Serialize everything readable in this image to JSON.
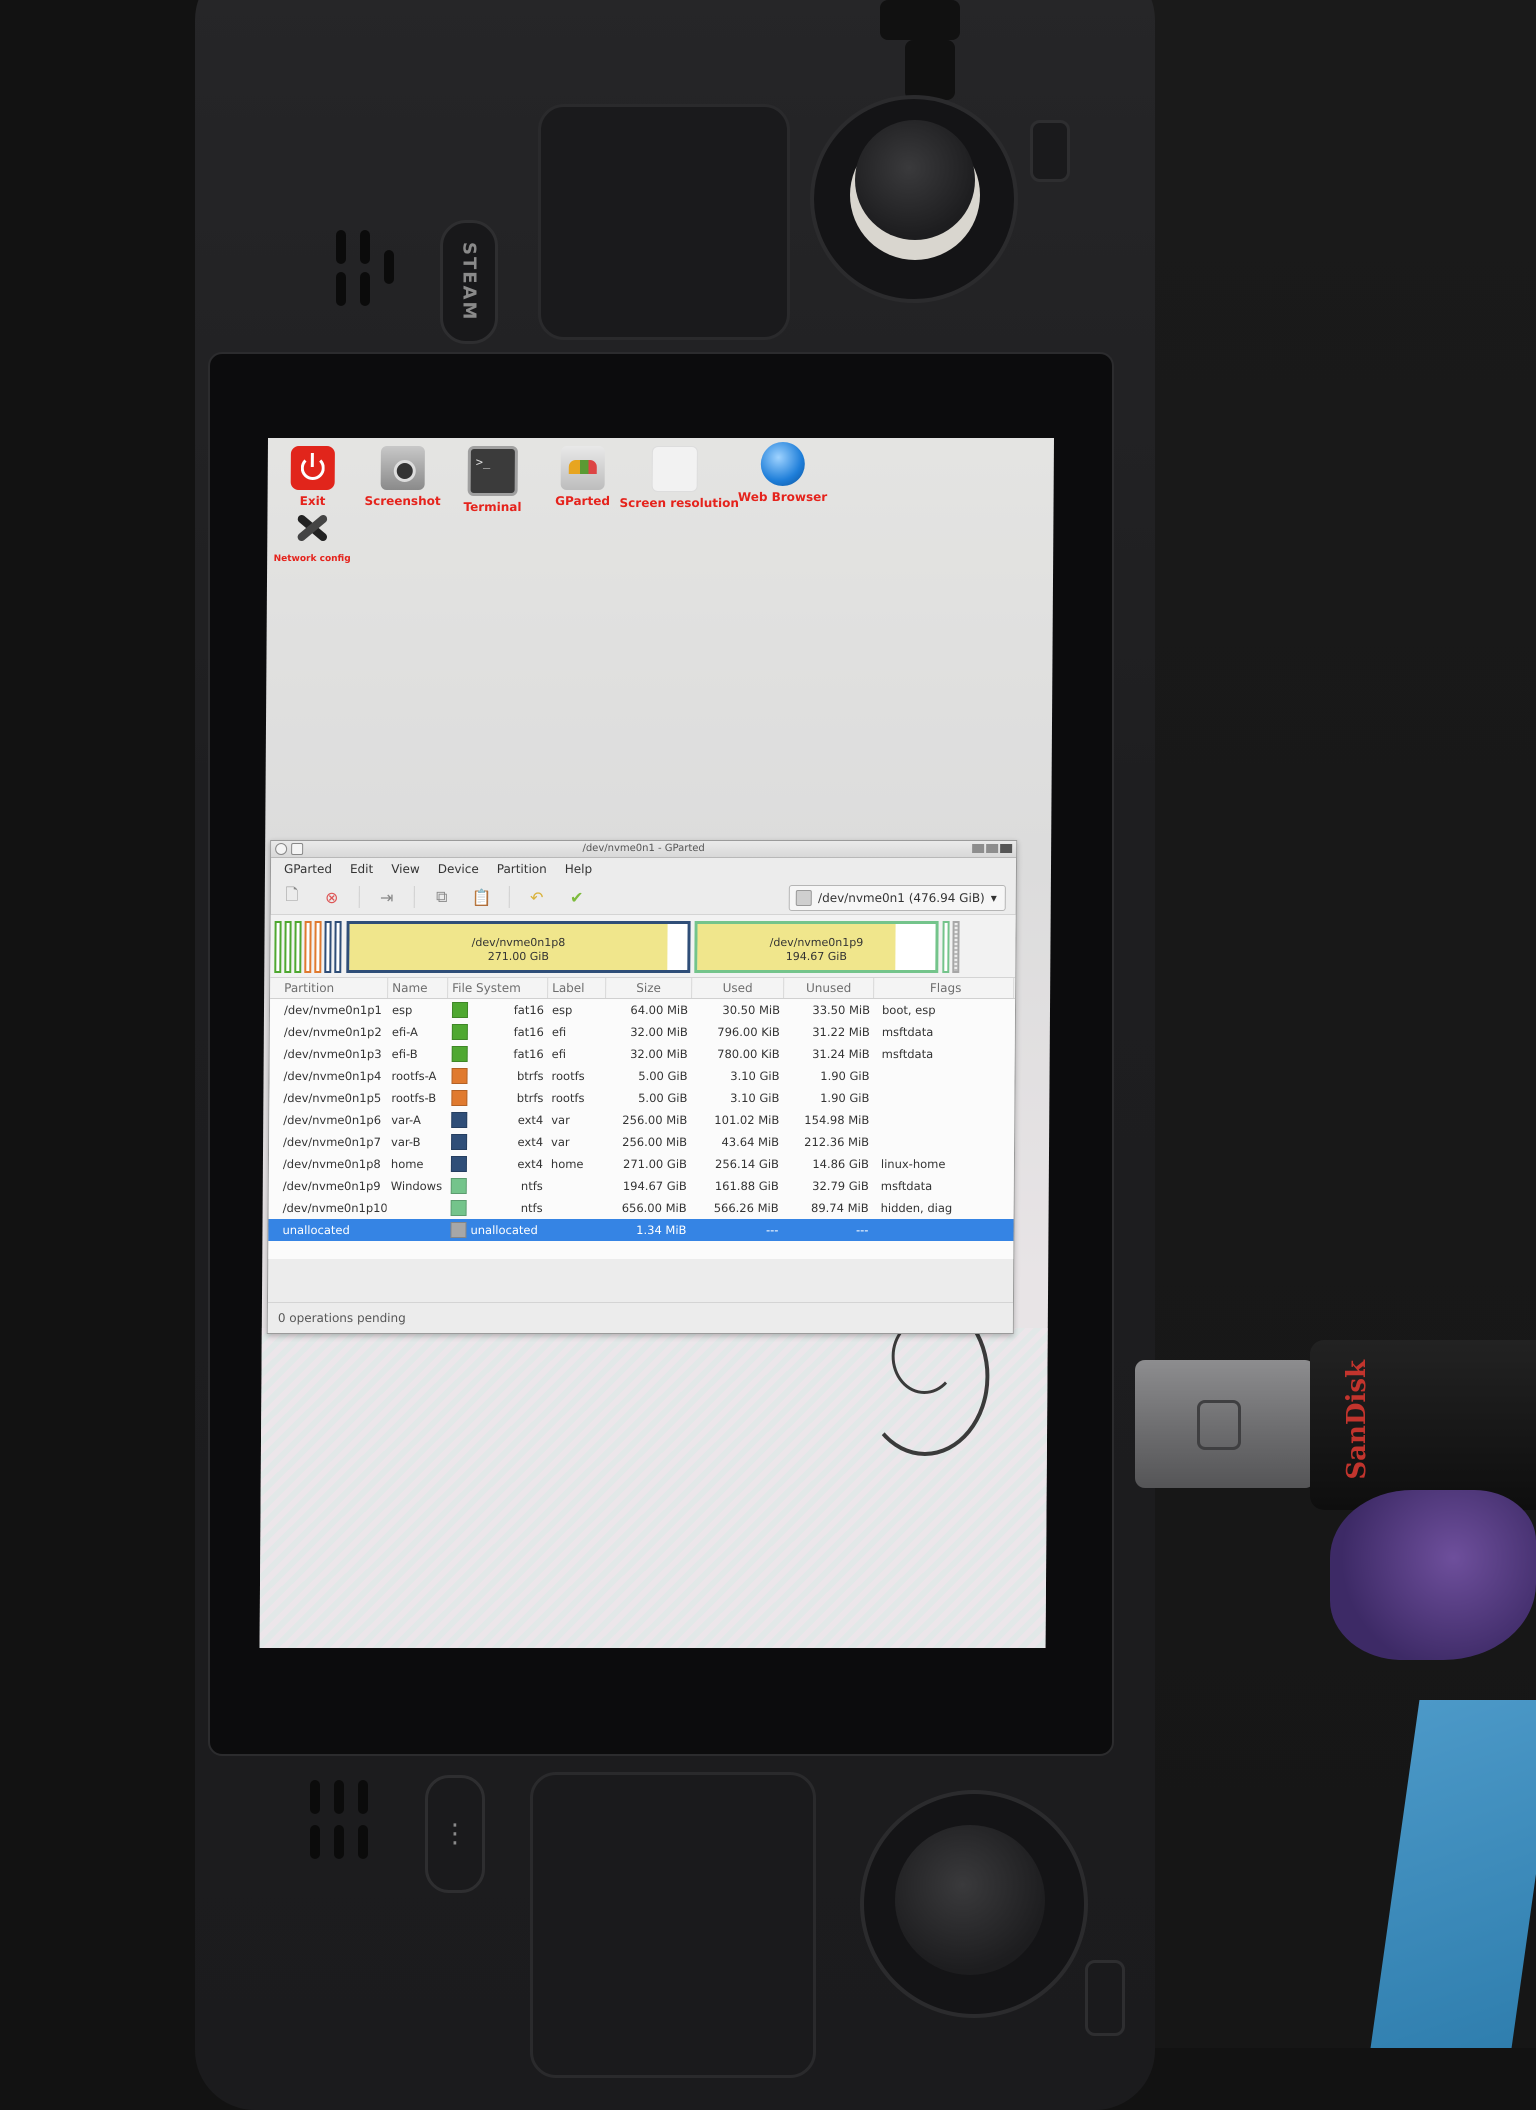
{
  "desktop": {
    "icons": [
      {
        "label": "Exit"
      },
      {
        "label": "Screenshot"
      },
      {
        "label": "Terminal"
      },
      {
        "label": "GParted"
      },
      {
        "label": "Screen resolution"
      },
      {
        "label": "Web Browser"
      },
      {
        "label": "Network config"
      }
    ]
  },
  "device": {
    "steam_label": "STEAM",
    "usb_brand": "SanDisk"
  },
  "window": {
    "title": "/dev/nvme0n1 - GParted",
    "menu": [
      "GParted",
      "Edit",
      "View",
      "Device",
      "Partition",
      "Help"
    ],
    "device_selector": "/dev/nvme0n1 (476.94 GiB)",
    "diskmap": [
      {
        "name": "/dev/nvme0n1p8",
        "size": "271.00 GiB",
        "used_fraction": 0.94
      },
      {
        "name": "/dev/nvme0n1p9",
        "size": "194.67 GiB",
        "used_fraction": 0.83
      }
    ],
    "columns": [
      "Partition",
      "Name",
      "File System",
      "Label",
      "Size",
      "Used",
      "Unused",
      "Flags"
    ],
    "rows": [
      {
        "partition": "/dev/nvme0n1p1",
        "name": "esp",
        "fs": "fat16",
        "color": "#4fa831",
        "label": "esp",
        "size": "64.00 MiB",
        "used": "30.50 MiB",
        "unused": "33.50 MiB",
        "flags": "boot, esp"
      },
      {
        "partition": "/dev/nvme0n1p2",
        "name": "efi-A",
        "fs": "fat16",
        "color": "#4fa831",
        "label": "efi",
        "size": "32.00 MiB",
        "used": "796.00 KiB",
        "unused": "31.22 MiB",
        "flags": "msftdata"
      },
      {
        "partition": "/dev/nvme0n1p3",
        "name": "efi-B",
        "fs": "fat16",
        "color": "#4fa831",
        "label": "efi",
        "size": "32.00 MiB",
        "used": "780.00 KiB",
        "unused": "31.24 MiB",
        "flags": "msftdata"
      },
      {
        "partition": "/dev/nvme0n1p4",
        "name": "rootfs-A",
        "fs": "btrfs",
        "color": "#e07a2f",
        "label": "rootfs",
        "size": "5.00 GiB",
        "used": "3.10 GiB",
        "unused": "1.90 GiB",
        "flags": ""
      },
      {
        "partition": "/dev/nvme0n1p5",
        "name": "rootfs-B",
        "fs": "btrfs",
        "color": "#e07a2f",
        "label": "rootfs",
        "size": "5.00 GiB",
        "used": "3.10 GiB",
        "unused": "1.90 GiB",
        "flags": ""
      },
      {
        "partition": "/dev/nvme0n1p6",
        "name": "var-A",
        "fs": "ext4",
        "color": "#2f4e78",
        "label": "var",
        "size": "256.00 MiB",
        "used": "101.02 MiB",
        "unused": "154.98 MiB",
        "flags": ""
      },
      {
        "partition": "/dev/nvme0n1p7",
        "name": "var-B",
        "fs": "ext4",
        "color": "#2f4e78",
        "label": "var",
        "size": "256.00 MiB",
        "used": "43.64 MiB",
        "unused": "212.36 MiB",
        "flags": ""
      },
      {
        "partition": "/dev/nvme0n1p8",
        "name": "home",
        "fs": "ext4",
        "color": "#2f4e78",
        "label": "home",
        "size": "271.00 GiB",
        "used": "256.14 GiB",
        "unused": "14.86 GiB",
        "flags": "linux-home"
      },
      {
        "partition": "/dev/nvme0n1p9",
        "name": "Windows",
        "fs": "ntfs",
        "color": "#74c48b",
        "label": "",
        "size": "194.67 GiB",
        "used": "161.88 GiB",
        "unused": "32.79 GiB",
        "flags": "msftdata"
      },
      {
        "partition": "/dev/nvme0n1p10",
        "name": "",
        "fs": "ntfs",
        "color": "#74c48b",
        "label": "",
        "size": "656.00 MiB",
        "used": "566.26 MiB",
        "unused": "89.74 MiB",
        "flags": "hidden, diag"
      },
      {
        "partition": "unallocated",
        "name": "",
        "fs": "unallocated",
        "color": "#a7a7a7",
        "label": "",
        "size": "1.34 MiB",
        "used": "---",
        "unused": "---",
        "flags": "",
        "selected": true
      }
    ],
    "status": "0 operations pending"
  }
}
